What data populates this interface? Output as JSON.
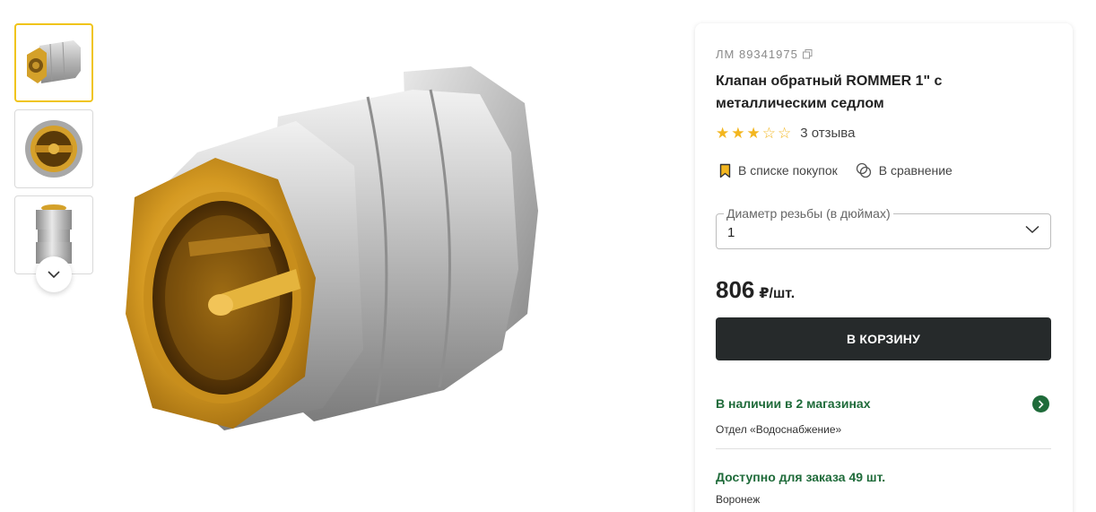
{
  "gallery": {
    "thumbnails": [
      "thumb-front",
      "thumb-inside",
      "thumb-side"
    ],
    "active_index": 0,
    "scroll_down_icon": "chevron-down-icon"
  },
  "product": {
    "article": "ЛМ 89341975",
    "copy_icon": "copy-icon",
    "title": "Клапан обратный ROMMER 1\" с металлическим седлом",
    "rating": 3,
    "rating_max": 5,
    "reviews": "3 отзыва",
    "shopping_list_label": "В списке покупок",
    "compare_label": "В сравнение",
    "option_label": "Диаметр резьбы (в дюймах)",
    "option_value": "1",
    "price": "806",
    "price_unit": "₽/шт.",
    "cart_button": "В КОРЗИНУ",
    "stock_text": "В наличии в 2 магазинах",
    "department": "Отдел «Водоснабжение»",
    "order_text": "Доступно для заказа 49 шт.",
    "city": "Воронеж"
  },
  "colors": {
    "accent_green": "#1f6b3a",
    "star": "#f3b61f",
    "active_thumb_border": "#f0c419",
    "cart_button_bg": "#262a2b"
  }
}
